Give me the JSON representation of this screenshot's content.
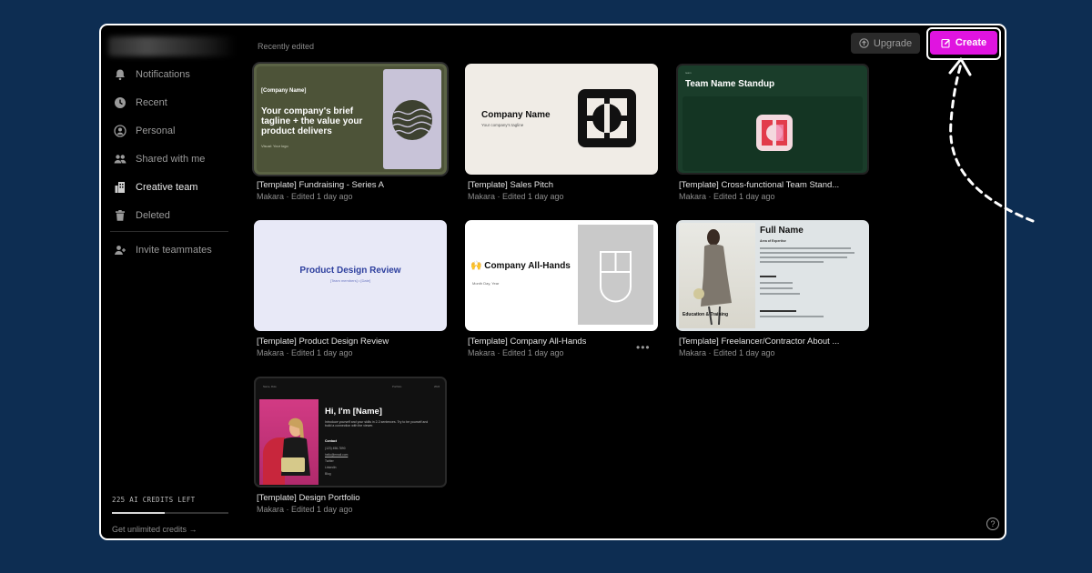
{
  "sidebar": {
    "items": [
      {
        "label": "Notifications",
        "icon": "bell-icon"
      },
      {
        "label": "Recent",
        "icon": "clock-icon"
      },
      {
        "label": "Personal",
        "icon": "user-icon"
      },
      {
        "label": "Shared with me",
        "icon": "users-icon"
      },
      {
        "label": "Creative team",
        "icon": "building-icon"
      },
      {
        "label": "Deleted",
        "icon": "trash-icon"
      }
    ],
    "invite_label": "Invite teammates",
    "credits_text": "225 AI CREDITS LEFT",
    "credits_fraction": 0.45,
    "unlimited_link": "Get unlimited credits →"
  },
  "header": {
    "section_title": "Recently edited",
    "upgrade_label": "Upgrade",
    "create_label": "Create",
    "accent_color": "#e014e0"
  },
  "cards": [
    {
      "title": "[Template] Fundraising - Series A",
      "meta": "Makara · Edited 1 day ago",
      "thumb": {
        "company": "[Company Name]",
        "tagline": "Your company's brief tagline + the value your product delivers",
        "small": "Visual: Your logo"
      }
    },
    {
      "title": "[Template] Sales Pitch",
      "meta": "Makara · Edited 1 day ago",
      "thumb": {
        "company": "Company Name",
        "sub": "Your company's tagline"
      }
    },
    {
      "title": "[Template] Cross-functional Team Stand...",
      "meta": "Makara · Edited 1 day ago",
      "thumb": {
        "mini": "team",
        "title": "Team Name Standup"
      }
    },
    {
      "title": "[Template] Product Design Review",
      "meta": "Makara · Edited 1 day ago",
      "thumb": {
        "title": "Product Design Review",
        "sub": "[Team members] • [Date]"
      }
    },
    {
      "title": "[Template] Company All-Hands",
      "meta": "Makara · Edited 1 day ago",
      "thumb": {
        "title": "🙌 Company All-Hands",
        "sub": "Month Day, Year"
      }
    },
    {
      "title": "[Template] Freelancer/Contractor About ...",
      "meta": "Makara · Edited 1 day ago",
      "thumb": {
        "name": "Full Name",
        "aoe": "Area of Expertise",
        "edu": "Education & Training"
      }
    },
    {
      "title": "[Template] Design Portfolio",
      "meta": "Makara · Edited 1 day ago",
      "thumb": {
        "hi": "Hi, I'm [Name]",
        "intro": "Introduce yourself and your skills in 2-3 sentences. Try to be yourself and build a connection with the viewer.",
        "contact": "Contact",
        "phone": "(123) 456-7890",
        "email": "hello@email.com",
        "links": [
          "Twitter",
          "LinkedIn",
          "Blog"
        ],
        "top_left": "Name, Role",
        "top_mid": "Portfolio",
        "top_right": "2024"
      }
    }
  ]
}
